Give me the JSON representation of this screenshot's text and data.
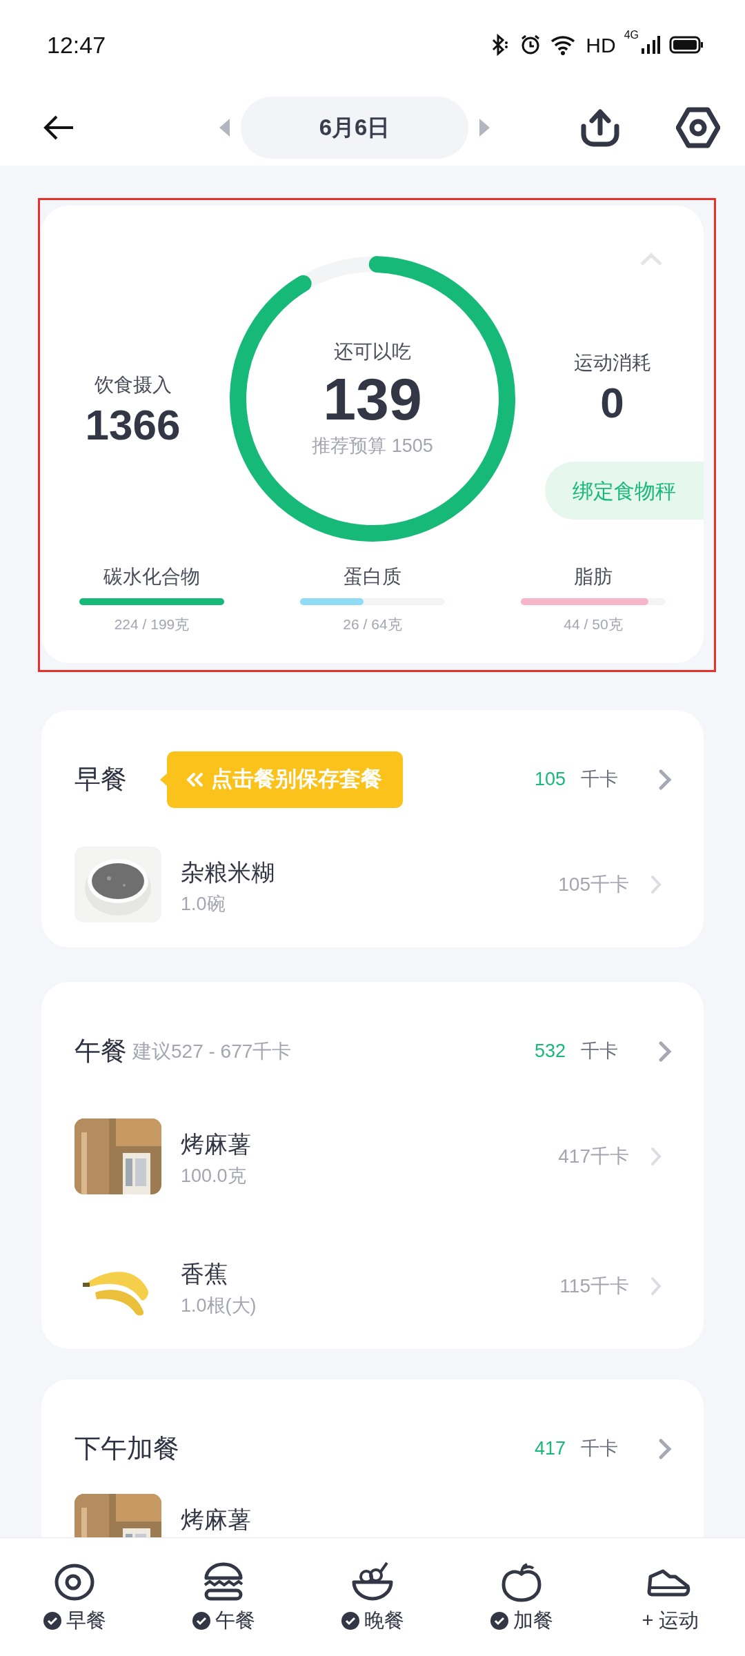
{
  "status_bar": {
    "time": "12:47",
    "network": "HD",
    "network_type": "4G"
  },
  "header": {
    "date": "6月6日"
  },
  "summary": {
    "intake_label": "饮食摄入",
    "intake": "1366",
    "remaining_label": "还可以吃",
    "remaining": "139",
    "budget": "推荐预算 1505",
    "level": 0.908,
    "exercise_label": "运动消耗",
    "exercise": "0",
    "scale_button": "绑定食物秤",
    "macros": [
      {
        "name": "碳水化合物",
        "reading": "224 / 199克",
        "level": 1,
        "color": "#17b978"
      },
      {
        "name": "蛋白质",
        "reading": "26 / 64克",
        "level": 0.44,
        "color": "#8fdcf7"
      },
      {
        "name": "脂肪",
        "reading": "44 / 50克",
        "level": 0.88,
        "color": "#f7b6c8"
      }
    ]
  },
  "meals": [
    {
      "title": "早餐",
      "tip": "点击餐别保存套餐",
      "calories": "105",
      "unit": "千卡",
      "items": [
        {
          "name": "杂粮米糊",
          "amount": "1.0碗",
          "calories": "105千卡",
          "kind": "picture"
        }
      ]
    },
    {
      "title": "午餐",
      "suggestion": "建议527 - 677千卡",
      "calories": "532",
      "unit": "千卡",
      "items": [
        {
          "name": "烤麻薯",
          "amount": "100.0克",
          "calories": "417千卡",
          "kind": "picture"
        },
        {
          "name": "香蕉",
          "amount": "1.0根(大)",
          "calories": "115千卡",
          "kind": "picture"
        }
      ]
    },
    {
      "title": "下午加餐",
      "calories": "417",
      "unit": "千卡",
      "items": [
        {
          "name": "烤麻薯",
          "kind": "picture"
        }
      ]
    }
  ],
  "bottom_nav": [
    {
      "label": "早餐",
      "checked": true
    },
    {
      "label": "午餐",
      "checked": true
    },
    {
      "label": "晚餐",
      "checked": true
    },
    {
      "label": "加餐",
      "checked": true
    },
    {
      "label": "+ 运动",
      "checked": false
    }
  ]
}
